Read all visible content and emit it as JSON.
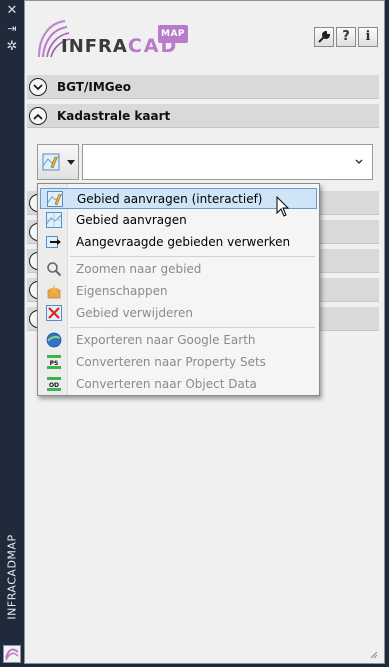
{
  "app": {
    "palette_title": "INFRACADMAP",
    "logo": {
      "word_left": "INFRA",
      "word_right": "CAD",
      "badge": "MAP"
    }
  },
  "header_tools": [
    {
      "name": "wrench-icon",
      "glyph": "🔧"
    },
    {
      "name": "help-icon",
      "glyph": "?"
    },
    {
      "name": "info-icon",
      "glyph": "i"
    }
  ],
  "sections": [
    {
      "label": "BGT/IMGeo",
      "expanded": false
    },
    {
      "label": "Kadastrale kaart",
      "expanded": true
    }
  ],
  "combo": {
    "value": ""
  },
  "menu": {
    "items": [
      {
        "label": "Gebied aanvragen (interactief)",
        "icon": "map-request-interactive-icon",
        "enabled": true,
        "highlighted": true
      },
      {
        "label": "Gebied aanvragen",
        "icon": "map-request-icon",
        "enabled": true
      },
      {
        "label": "Aangevraagde gebieden verwerken",
        "icon": "process-areas-icon",
        "enabled": true
      },
      {
        "label": "Zoomen naar gebied",
        "icon": "zoom-icon",
        "enabled": false
      },
      {
        "label": "Eigenschappen",
        "icon": "properties-icon",
        "enabled": false
      },
      {
        "label": "Gebied verwijderen",
        "icon": "delete-icon",
        "enabled": false
      },
      {
        "label": "Exporteren naar Google Earth",
        "icon": "google-earth-icon",
        "enabled": false
      },
      {
        "label": "Converteren naar Property Sets",
        "icon": "property-sets-icon",
        "enabled": false
      },
      {
        "label": "Converteren naar Object Data",
        "icon": "object-data-icon",
        "enabled": false
      }
    ]
  },
  "colors": {
    "accent": "#b77bc9",
    "highlight": "#cfe5f7",
    "highlight_border": "#5f9fd3",
    "titlebar": "#1f2b3a"
  }
}
